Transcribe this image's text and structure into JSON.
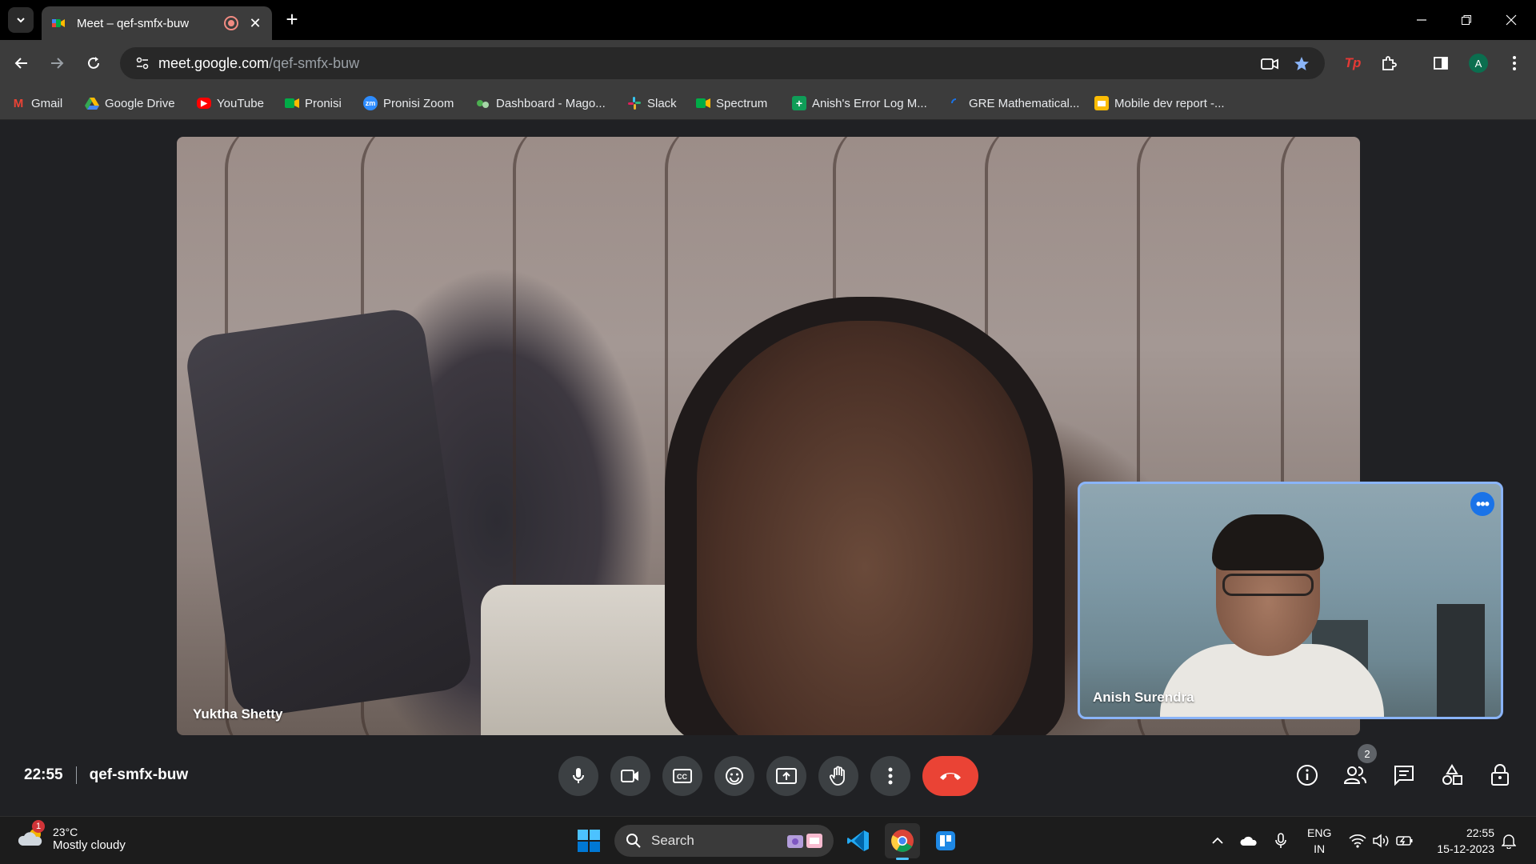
{
  "browser": {
    "tab_title": "Meet – qef-smfx-buw",
    "url_host": "meet.google.com",
    "url_path": "/qef-smfx-buw",
    "profile_initial": "A"
  },
  "bookmarks": [
    {
      "label": "Gmail",
      "icon": "gmail-icon",
      "color": "#ea4335"
    },
    {
      "label": "Google Drive",
      "icon": "google-drive-icon",
      "color": "#34a853"
    },
    {
      "label": "YouTube",
      "icon": "youtube-icon",
      "color": "#ff0000"
    },
    {
      "label": "Pronisi",
      "icon": "meet-icon",
      "color": "#00897b"
    },
    {
      "label": "Pronisi Zoom",
      "icon": "zoom-icon",
      "color": "#2d8cff"
    },
    {
      "label": "Dashboard - Mago...",
      "icon": "dashboard-icon",
      "color": "#4caf50"
    },
    {
      "label": "Slack",
      "icon": "slack-icon",
      "color": "#e01e5a"
    },
    {
      "label": "Spectrum",
      "icon": "meet-icon",
      "color": "#00897b"
    },
    {
      "label": "Anish's Error Log M...",
      "icon": "sheets-icon",
      "color": "#0f9d58"
    },
    {
      "label": "GRE Mathematical...",
      "icon": "loading-icon",
      "color": "#1a73e8"
    },
    {
      "label": "Mobile dev report -...",
      "icon": "slides-icon",
      "color": "#fbbc04"
    }
  ],
  "meet": {
    "main_participant": "Yuktha Shetty",
    "self_participant": "Anish Surendra",
    "time": "22:55",
    "meeting_code": "qef-smfx-buw",
    "participant_count": "2",
    "self_more_label": "•••"
  },
  "taskbar": {
    "weather_temp": "23°C",
    "weather_desc": "Mostly cloudy",
    "weather_badge": "1",
    "search_label": "Search",
    "lang_line1": "ENG",
    "lang_line2": "IN",
    "clock_time": "22:55",
    "clock_date": "15-12-2023"
  },
  "colors": {
    "accent_blue": "#8ab4f8",
    "end_call_red": "#ea4335",
    "control_gray": "#3c4043"
  }
}
